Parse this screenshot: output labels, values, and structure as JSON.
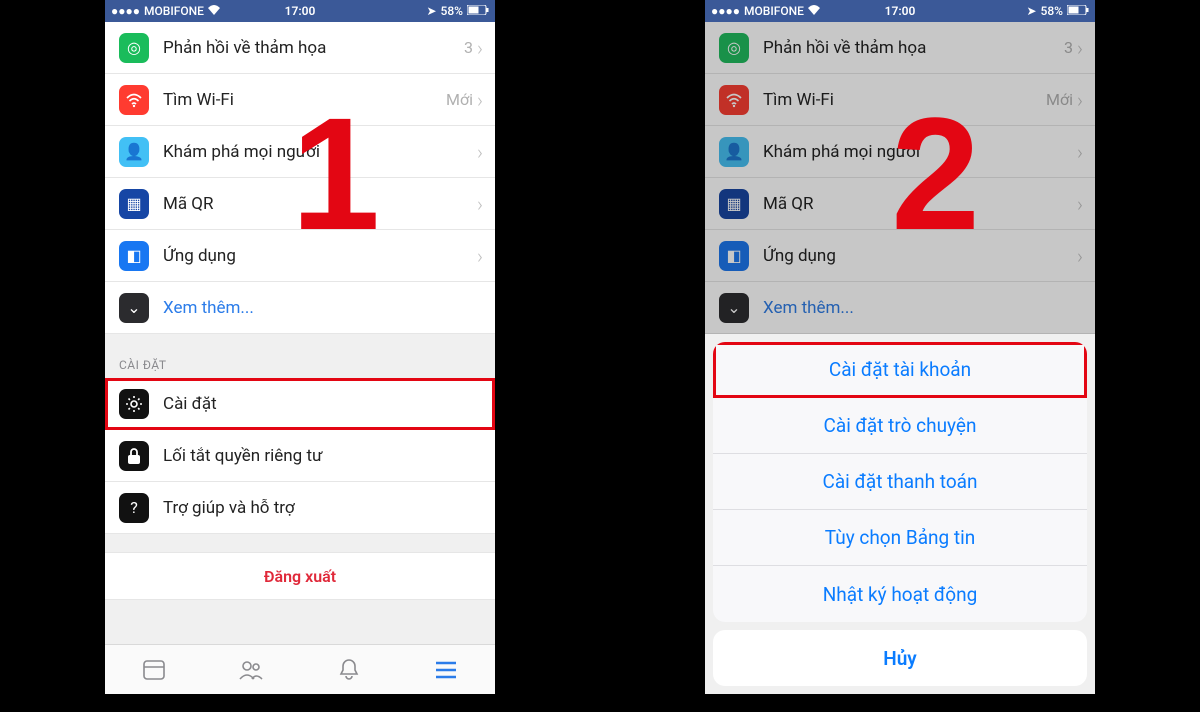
{
  "statusbar": {
    "carrier": "MOBIFONE",
    "time": "17:00",
    "battery": "58%"
  },
  "menu": {
    "items": [
      {
        "label": "Phản hồi về thảm họa",
        "accessory": "3"
      },
      {
        "label": "Tìm Wi-Fi",
        "accessory": "Mới"
      },
      {
        "label": "Khám phá mọi người",
        "accessory": ""
      },
      {
        "label": "Mã QR",
        "accessory": ""
      },
      {
        "label": "Ứng dụng",
        "accessory": ""
      }
    ],
    "see_more": "Xem thêm..."
  },
  "settings_section": {
    "header": "CÀI ĐẶT",
    "items": [
      {
        "label": "Cài đặt"
      },
      {
        "label": "Lối tắt quyền riêng tư"
      },
      {
        "label": "Trợ giúp và hỗ trợ"
      }
    ]
  },
  "logout": "Đăng xuất",
  "step1": "1",
  "step2": "2",
  "actionsheet": {
    "items": [
      "Cài đặt tài khoản",
      "Cài đặt trò chuyện",
      "Cài đặt thanh toán",
      "Tùy chọn Bảng tin",
      "Nhật ký hoạt động"
    ],
    "cancel": "Hủy"
  }
}
